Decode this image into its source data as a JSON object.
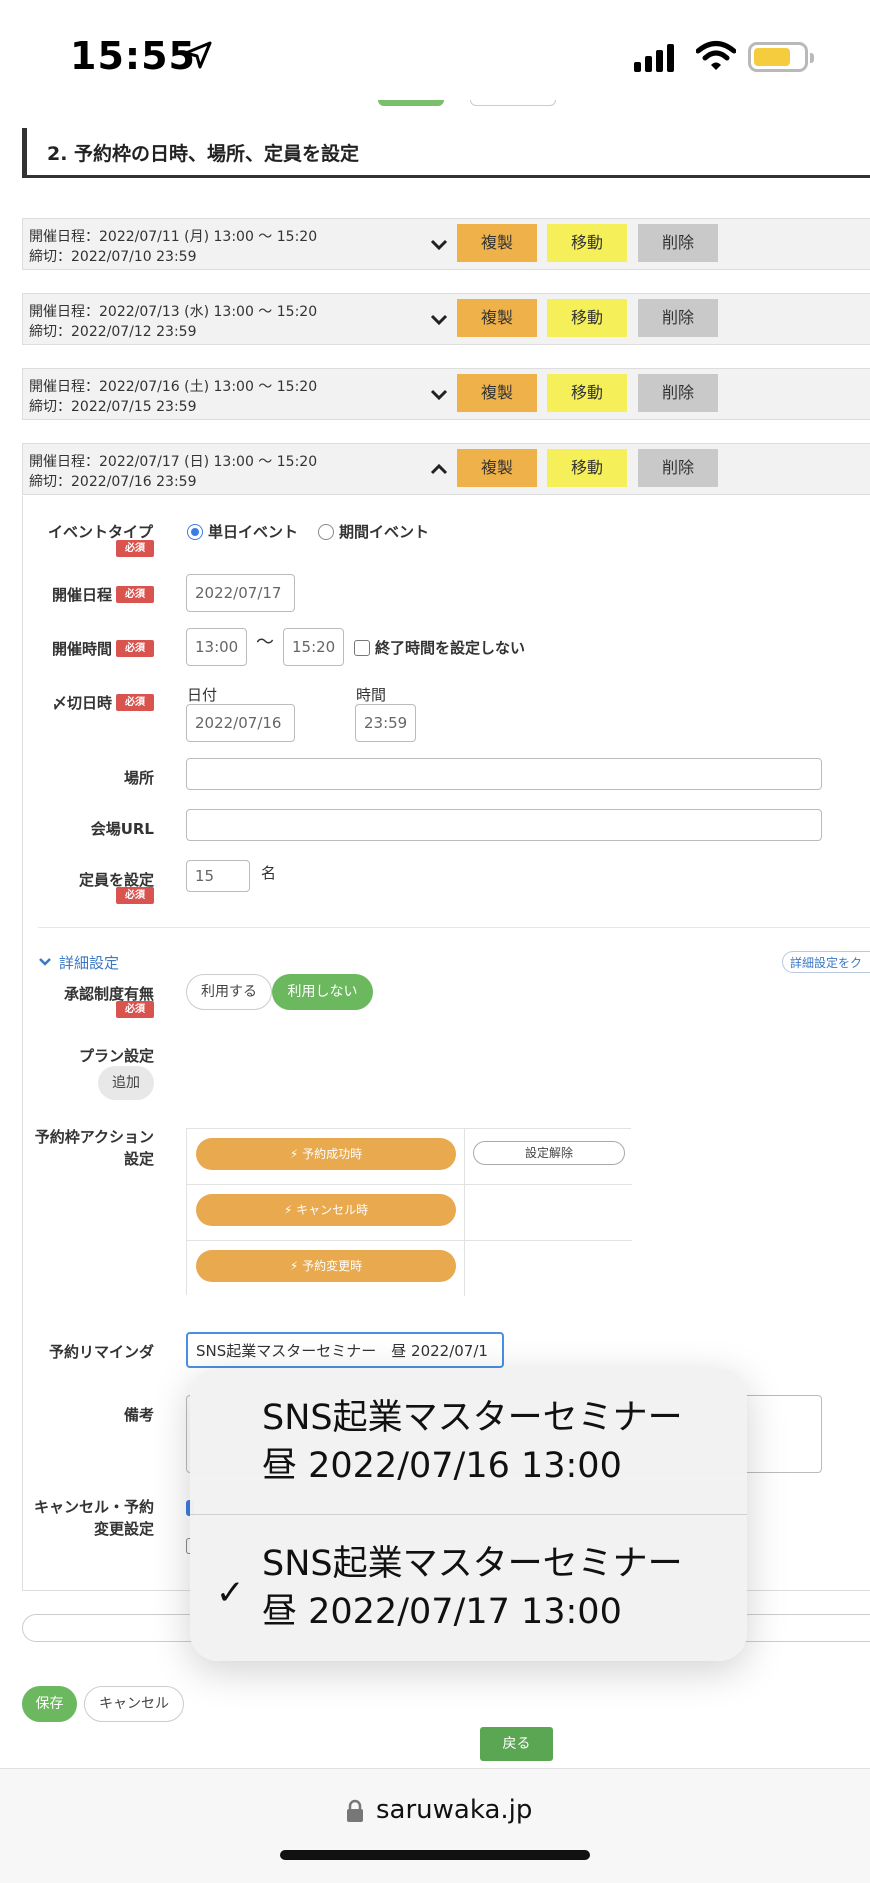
{
  "status_bar": {
    "time": "15:55",
    "battery_color": "#f5cc3d"
  },
  "section": {
    "title": "2. 予約枠の日時、場所、定員を設定"
  },
  "slots": [
    {
      "line1": "開催日程：2022/07/11 (月) 13:00 〜 15:20",
      "line2": "締切：2022/07/10 23:59",
      "expanded": false
    },
    {
      "line1": "開催日程：2022/07/13 (水) 13:00 〜 15:20",
      "line2": "締切：2022/07/12 23:59",
      "expanded": false
    },
    {
      "line1": "開催日程：2022/07/16 (土) 13:00 〜 15:20",
      "line2": "締切：2022/07/15 23:59",
      "expanded": false
    },
    {
      "line1": "開催日程：2022/07/17 (日) 13:00 〜 15:20",
      "line2": "締切：2022/07/16 23:59",
      "expanded": true
    }
  ],
  "slot_buttons": {
    "duplicate": "複製",
    "move": "移動",
    "delete": "削除"
  },
  "form": {
    "required_badge": "必須",
    "event_type": {
      "label": "イベントタイプ",
      "option_single": "単日イベント",
      "option_period": "期間イベント",
      "selected": "単日イベント"
    },
    "date": {
      "label": "開催日程",
      "value": "2022/07/17"
    },
    "time": {
      "label": "開催時間",
      "start": "13:00",
      "tilde": "〜",
      "end": "15:20",
      "no_end_label": "終了時間を設定しない"
    },
    "deadline": {
      "label": "〆切日時",
      "date_caption": "日付",
      "date_value": "2022/07/16",
      "time_caption": "時間",
      "time_value": "23:59"
    },
    "place": {
      "label": "場所",
      "value": ""
    },
    "venue_url": {
      "label": "会場URL",
      "value": ""
    },
    "capacity": {
      "label": "定員を設定",
      "value": "15",
      "unit": "名"
    },
    "details_toggle": "詳細設定",
    "details_right_link": "詳細設定をク",
    "approval": {
      "label": "承認制度有無",
      "use": "利用する",
      "not_use": "利用しない",
      "selected": "利用しない"
    },
    "plan": {
      "label": "プラン設定",
      "add": "追加"
    },
    "actions": {
      "label": "予約枠アクション設定",
      "success": "予約成功時",
      "cancel": "キャンセル時",
      "change": "予約変更時",
      "unset": "設定解除"
    },
    "reminder": {
      "label": "予約リマインダ",
      "value": "SNS起業マスターセミナー　昼 2022/07/1"
    },
    "notes": {
      "label": "備考"
    },
    "cancel_change": {
      "label": "キャンセル・予約変更設定"
    }
  },
  "popup": {
    "options": [
      {
        "line1": "SNS起業マスターセミナー",
        "line2": "昼 2022/07/16 13:00",
        "checked": false
      },
      {
        "line1": "SNS起業マスターセミナー",
        "line2": "昼 2022/07/17 13:00",
        "checked": true
      }
    ]
  },
  "footer_buttons": {
    "save": "保存",
    "cancel": "キャンセル",
    "back": "戻る"
  },
  "browser": {
    "url": "saruwaka.jp"
  }
}
